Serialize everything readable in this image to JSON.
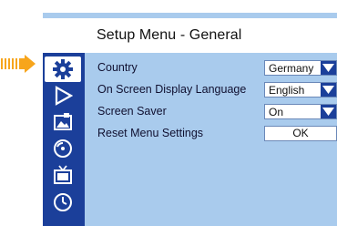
{
  "menu": {
    "title": "Setup Menu - General"
  },
  "sidebar": {
    "items": [
      {
        "icon": "gear-icon",
        "active": true
      },
      {
        "icon": "play-icon"
      },
      {
        "icon": "image-icon"
      },
      {
        "icon": "audio-disc-icon"
      },
      {
        "icon": "tv-icon"
      },
      {
        "icon": "clock-icon"
      }
    ]
  },
  "settings": [
    {
      "label": "Country",
      "value": "Germany",
      "type": "dropdown"
    },
    {
      "label": "On Screen Display Language",
      "value": "English",
      "type": "dropdown"
    },
    {
      "label": "Screen Saver",
      "value": "On",
      "type": "dropdown"
    },
    {
      "label": "Reset Menu Settings",
      "value": "OK",
      "type": "button"
    }
  ],
  "colors": {
    "panel": "#a9cbed",
    "sidebar": "#1b3f9a",
    "pointer": "#f7a51c"
  }
}
